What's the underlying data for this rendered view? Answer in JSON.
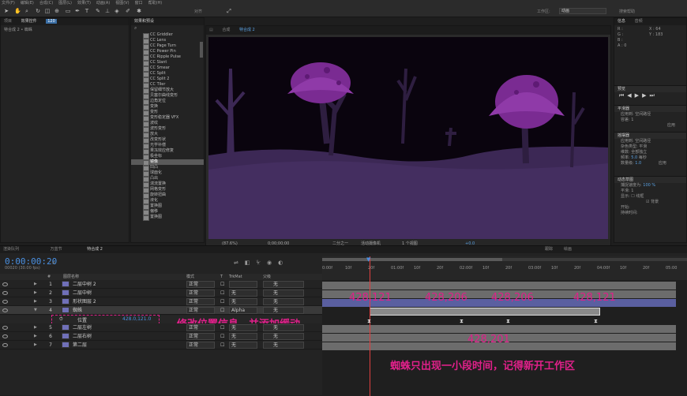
{
  "menu": [
    "文件(F)",
    "编辑(E)",
    "合成(C)",
    "图层(L)",
    "效果(T)",
    "动画(A)",
    "视图(V)",
    "窗口",
    "帮助(H)"
  ],
  "toolbar": {
    "align_label": "对齐",
    "workspace_label": "工作区:",
    "workspace_value": "动画",
    "search_placeholder": "搜索帮助"
  },
  "project_panel": {
    "tab": "项目",
    "effects_tab": "效果控件",
    "effects_badge": "120",
    "subtitle": "特合成 2 • 蜘蛛"
  },
  "effects_panel": {
    "tab": "效果和预设",
    "items": [
      "CC Griddler",
      "CC Lens",
      "CC Page Turn",
      "CC Power Pin",
      "CC Ripple Pulse",
      "CC Slant",
      "CC Smear",
      "CC Split",
      "CC Split 2",
      "CC Tiler",
      "保留细节放大",
      "贝塞尔曲线变形",
      "边角定位",
      "变换",
      "变形",
      "变形稳定器 VFX",
      "波纹",
      "波形变形",
      "放大",
      "改变形状",
      "光学补偿",
      "果冻效应修复",
      "极坐标",
      "镜像",
      "凹凸",
      "球面化",
      "凸出",
      "湍流置换",
      "网格变形",
      "旋转扭曲",
      "液化",
      "置换图",
      "偏移",
      "置换图"
    ],
    "selected_index": 23
  },
  "comp_panel": {
    "tab": "合成",
    "comp_name": "特合成 2",
    "zoom": "(87.6%)",
    "timecode": "0;00;00;00",
    "res": "二分之一",
    "camera": "活动摄像机",
    "views": "1 个视图",
    "exposure": "+0.0"
  },
  "info_panel": {
    "tab1": "信息",
    "tab2": "音频",
    "r": "R :",
    "g": "G :",
    "b": "B :",
    "a": "A : 0",
    "x": "X : 64",
    "y": "Y : 183"
  },
  "preview_panel": {
    "tab": "预览"
  },
  "smoother_panel": {
    "tab": "平滑器",
    "apply_to": "应用到:",
    "apply_value": "空间路径",
    "tolerance": "容差: 1",
    "apply_btn": "应用"
  },
  "wiggler_panel": {
    "tab": "摇摆器",
    "apply_to": "应用到:",
    "apply_value": "空间路径",
    "noise": "杂色类型:",
    "noise_value": "平滑",
    "dimension": "维数:",
    "dimension_value": "全部独立",
    "freq_label": "频率:",
    "freq": "5.0",
    "freq_unit": "每秒",
    "mag_label": "数量级:",
    "mag": "1.0",
    "apply_btn": "应用"
  },
  "motion_sketch_panel": {
    "tab": "动态草图",
    "capture_speed": "捕捉速度为:",
    "capture_value": "100 %",
    "smooth": "平滑:",
    "smooth_value": "1",
    "show": "显示:",
    "wireframe": "线框",
    "background": "背景",
    "start": "开始:",
    "duration": "持续时间:"
  },
  "timeline": {
    "tabs": [
      "渲染队列",
      "万蓝节",
      "特合成 2"
    ],
    "bottom_tabs": [
      "跟踪",
      "绘画"
    ],
    "timecode": "0:00:00:20",
    "fps": "00020 (30.00 fps)",
    "headers": {
      "num": "#",
      "name": "图层名称",
      "mode": "模式",
      "t": "T",
      "trkmat": "TrkMat",
      "parent": "父级"
    },
    "ruler": [
      "0:00f",
      "10f",
      "20f",
      "01:00f",
      "10f",
      "20f",
      "02:00f",
      "10f",
      "20f",
      "03:00f",
      "10f",
      "20f",
      "04:00f",
      "10f",
      "20f",
      "05:00"
    ],
    "layers": [
      {
        "num": "1",
        "name": "二层中树 2",
        "mode": "正常",
        "trk": "",
        "parent": "无"
      },
      {
        "num": "2",
        "name": "二层中树",
        "mode": "正常",
        "trk": "无",
        "parent": "无"
      },
      {
        "num": "3",
        "name": "形状图层 2",
        "mode": "正常",
        "trk": "无",
        "parent": "无"
      },
      {
        "num": "4",
        "name": "蜘蛛",
        "mode": "正常",
        "trk": "Alpha",
        "parent": "无"
      },
      {
        "num": "5",
        "name": "二层左树",
        "mode": "正常",
        "trk": "无",
        "parent": "无"
      },
      {
        "num": "6",
        "name": "二层右树",
        "mode": "正常",
        "trk": "无",
        "parent": "无"
      },
      {
        "num": "7",
        "name": "第二层",
        "mode": "正常",
        "trk": "无",
        "parent": "无"
      }
    ],
    "position_prop": {
      "name": "位置",
      "value": "428.0,121.0"
    }
  },
  "annotations": {
    "a1": "428,121",
    "a2": "428,206",
    "a3": "428,206",
    "a4": "428,121",
    "a5": "428,201",
    "note1": "修改位置信息，并添加缓动",
    "note2": "蜘蛛只出现一小段时间，记得新开工作区",
    "color": "#e0208a"
  }
}
